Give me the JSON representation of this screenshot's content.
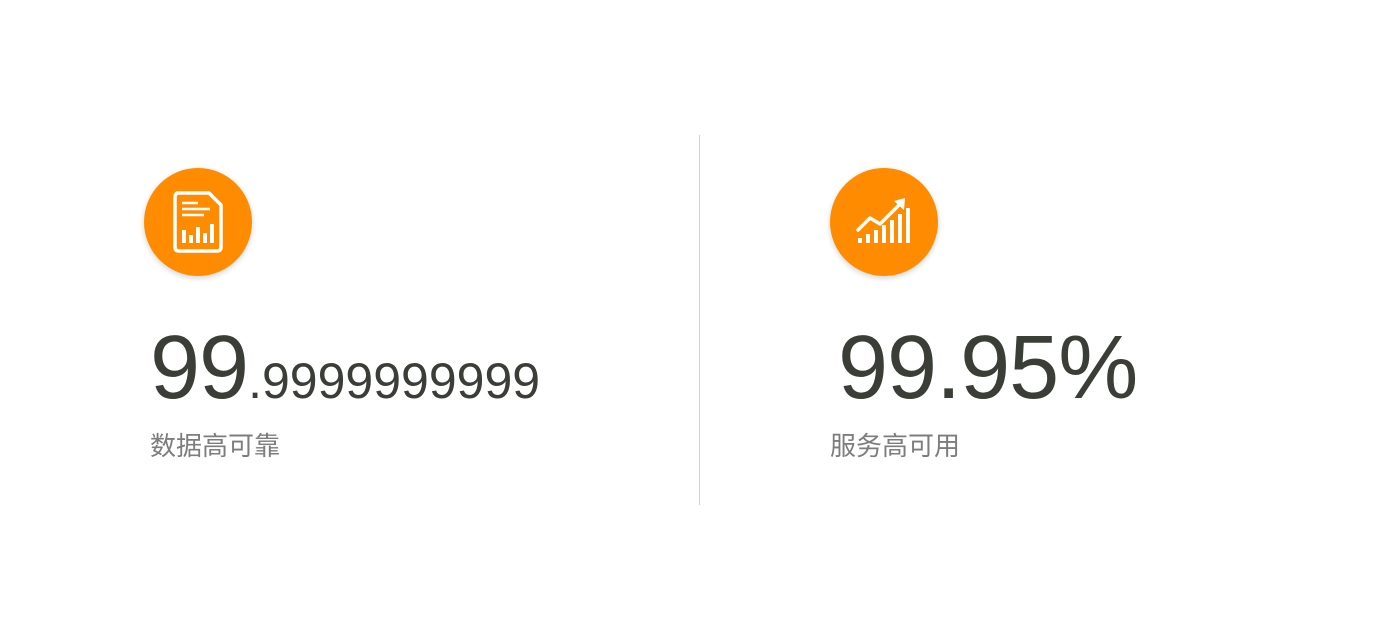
{
  "stats": [
    {
      "icon": "report-document-icon",
      "value_main": "99",
      "value_small": ".9999999999",
      "label": "数据高可靠"
    },
    {
      "icon": "growth-chart-icon",
      "value_main": "99.95%",
      "value_small": "",
      "label": "服务高可用"
    }
  ],
  "colors": {
    "accent": "#ff8c00",
    "value_text": "#3a3e36",
    "label_text": "#7d7d7d",
    "divider": "#d4d4d4"
  }
}
